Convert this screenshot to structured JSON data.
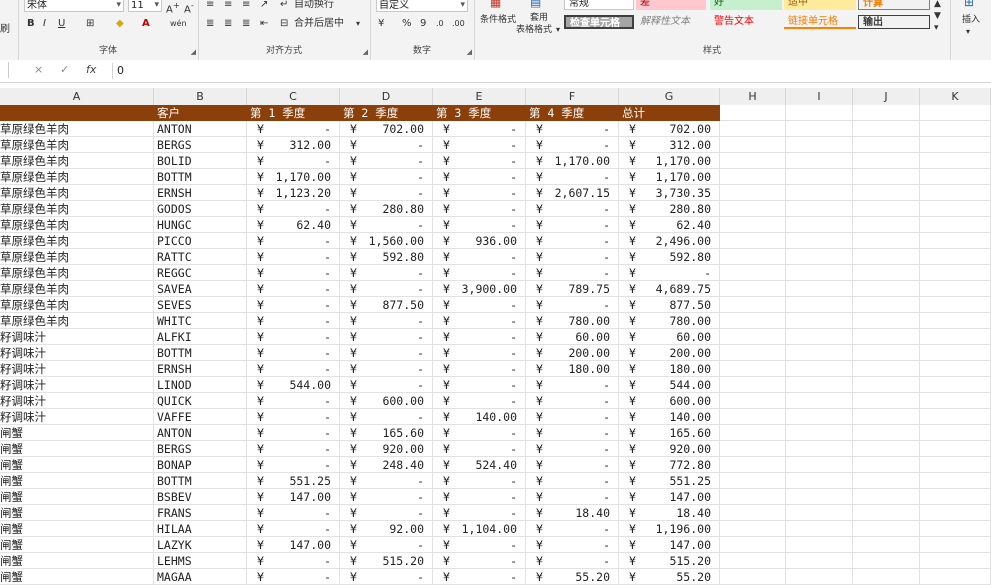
{
  "ribbon": {
    "font_name": "宋体",
    "font_size": "11",
    "group_font": "字体",
    "group_align": "对齐方式",
    "group_number": "数字",
    "group_styles": "样式",
    "left_partial": "刷",
    "wrap_text": "自动换行",
    "merge_center": "合并后居中",
    "number_format": "自定义",
    "cond_format": "条件格式",
    "table_format_1": "套用",
    "table_format_2": "表格格式",
    "insert": "插入",
    "percent": "%",
    "comma": "9",
    "styles": {
      "normal": "常规",
      "bad": "差",
      "good": "好",
      "neutral": "适中",
      "calc": "计算",
      "check": "检查单元格",
      "explain": "解释性文本",
      "warn": "警告文本",
      "link": "链接单元格",
      "output": "输出"
    }
  },
  "formula_bar": {
    "cancel": "×",
    "enter": "✓",
    "fx": "fx",
    "value": "0"
  },
  "columns": [
    "A",
    "B",
    "C",
    "D",
    "E",
    "F",
    "G",
    "H",
    "I",
    "J",
    "K"
  ],
  "header_row": {
    "a": "",
    "b": "客户",
    "c": "第 1 季度",
    "d": "第 2 季度",
    "e": "第 3 季度",
    "f": "第 4 季度",
    "g": "总计"
  },
  "currency": "¥",
  "rows": [
    {
      "a": "草原绿色羊肉",
      "b": "ANTON",
      "c": "-",
      "d": "702.00",
      "e": "-",
      "f": "-",
      "g": "702.00"
    },
    {
      "a": "草原绿色羊肉",
      "b": "BERGS",
      "c": "312.00",
      "d": "-",
      "e": "-",
      "f": "-",
      "g": "312.00"
    },
    {
      "a": "草原绿色羊肉",
      "b": "BOLID",
      "c": "-",
      "d": "-",
      "e": "-",
      "f": "1,170.00",
      "g": "1,170.00"
    },
    {
      "a": "草原绿色羊肉",
      "b": "BOTTM",
      "c": "1,170.00",
      "d": "-",
      "e": "-",
      "f": "-",
      "g": "1,170.00"
    },
    {
      "a": "草原绿色羊肉",
      "b": "ERNSH",
      "c": "1,123.20",
      "d": "-",
      "e": "-",
      "f": "2,607.15",
      "g": "3,730.35"
    },
    {
      "a": "草原绿色羊肉",
      "b": "GODOS",
      "c": "-",
      "d": "280.80",
      "e": "-",
      "f": "-",
      "g": "280.80"
    },
    {
      "a": "草原绿色羊肉",
      "b": "HUNGC",
      "c": "62.40",
      "d": "-",
      "e": "-",
      "f": "-",
      "g": "62.40"
    },
    {
      "a": "草原绿色羊肉",
      "b": "PICCO",
      "c": "-",
      "d": "1,560.00",
      "e": "936.00",
      "f": "-",
      "g": "2,496.00"
    },
    {
      "a": "草原绿色羊肉",
      "b": "RATTC",
      "c": "-",
      "d": "592.80",
      "e": "-",
      "f": "-",
      "g": "592.80"
    },
    {
      "a": "草原绿色羊肉",
      "b": "REGGC",
      "c": "-",
      "d": "-",
      "e": "-",
      "f": "-",
      "g": "-"
    },
    {
      "a": "草原绿色羊肉",
      "b": "SAVEA",
      "c": "-",
      "d": "-",
      "e": "3,900.00",
      "f": "789.75",
      "g": "4,689.75"
    },
    {
      "a": "草原绿色羊肉",
      "b": "SEVES",
      "c": "-",
      "d": "877.50",
      "e": "-",
      "f": "-",
      "g": "877.50"
    },
    {
      "a": "草原绿色羊肉",
      "b": "WHITC",
      "c": "-",
      "d": "-",
      "e": "-",
      "f": "780.00",
      "g": "780.00"
    },
    {
      "a": "籽调味汁",
      "b": "ALFKI",
      "c": "-",
      "d": "-",
      "e": "-",
      "f": "60.00",
      "g": "60.00"
    },
    {
      "a": "籽调味汁",
      "b": "BOTTM",
      "c": "-",
      "d": "-",
      "e": "-",
      "f": "200.00",
      "g": "200.00"
    },
    {
      "a": "籽调味汁",
      "b": "ERNSH",
      "c": "-",
      "d": "-",
      "e": "-",
      "f": "180.00",
      "g": "180.00"
    },
    {
      "a": "籽调味汁",
      "b": "LINOD",
      "c": "544.00",
      "d": "-",
      "e": "-",
      "f": "-",
      "g": "544.00"
    },
    {
      "a": "籽调味汁",
      "b": "QUICK",
      "c": "-",
      "d": "600.00",
      "e": "-",
      "f": "-",
      "g": "600.00"
    },
    {
      "a": "籽调味汁",
      "b": "VAFFE",
      "c": "-",
      "d": "-",
      "e": "140.00",
      "f": "-",
      "g": "140.00"
    },
    {
      "a": "闸蟹",
      "b": "ANTON",
      "c": "-",
      "d": "165.60",
      "e": "-",
      "f": "-",
      "g": "165.60"
    },
    {
      "a": "闸蟹",
      "b": "BERGS",
      "c": "-",
      "d": "920.00",
      "e": "-",
      "f": "-",
      "g": "920.00"
    },
    {
      "a": "闸蟹",
      "b": "BONAP",
      "c": "-",
      "d": "248.40",
      "e": "524.40",
      "f": "-",
      "g": "772.80"
    },
    {
      "a": "闸蟹",
      "b": "BOTTM",
      "c": "551.25",
      "d": "-",
      "e": "-",
      "f": "-",
      "g": "551.25"
    },
    {
      "a": "闸蟹",
      "b": "BSBEV",
      "c": "147.00",
      "d": "-",
      "e": "-",
      "f": "-",
      "g": "147.00"
    },
    {
      "a": "闸蟹",
      "b": "FRANS",
      "c": "-",
      "d": "-",
      "e": "-",
      "f": "18.40",
      "g": "18.40"
    },
    {
      "a": "闸蟹",
      "b": "HILAA",
      "c": "-",
      "d": "92.00",
      "e": "1,104.00",
      "f": "-",
      "g": "1,196.00"
    },
    {
      "a": "闸蟹",
      "b": "LAZYK",
      "c": "147.00",
      "d": "-",
      "e": "-",
      "f": "-",
      "g": "147.00"
    },
    {
      "a": "闸蟹",
      "b": "LEHMS",
      "c": "-",
      "d": "515.20",
      "e": "-",
      "f": "-",
      "g": "515.20"
    },
    {
      "a": "闸蟹",
      "b": "MAGAA",
      "c": "-",
      "d": "-",
      "e": "-",
      "f": "55.20",
      "g": "55.20"
    }
  ]
}
